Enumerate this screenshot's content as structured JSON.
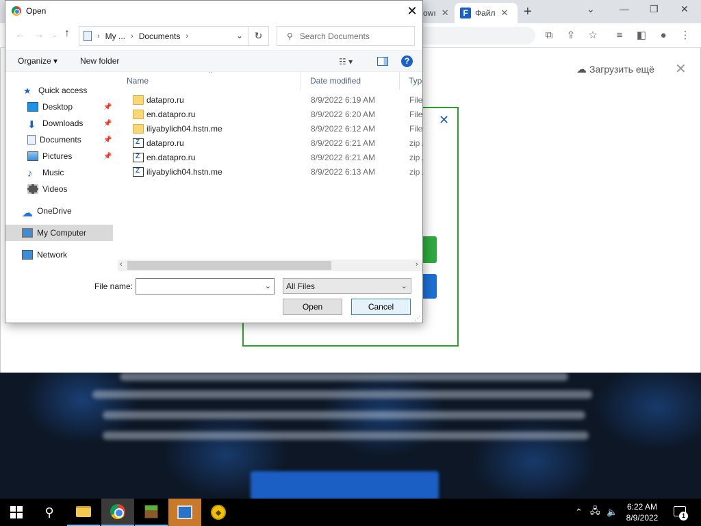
{
  "browser": {
    "tab_partial_label": "owı",
    "tab_active_label": "Файл",
    "tab_active_icon": "F",
    "upload_more": "Загрузить ещё"
  },
  "dialog": {
    "title": "Open",
    "breadcrumb": [
      "My ...",
      "Documents"
    ],
    "search_placeholder": "Search Documents",
    "organize": "Organize",
    "new_folder": "New folder",
    "help": "?",
    "nav": [
      {
        "label": "Quick access",
        "icon": "star-icon",
        "pinned": false
      },
      {
        "label": "Desktop",
        "icon": "desktop-icon",
        "pinned": true
      },
      {
        "label": "Downloads",
        "icon": "download-icon",
        "pinned": true
      },
      {
        "label": "Documents",
        "icon": "document-icon",
        "pinned": true
      },
      {
        "label": "Pictures",
        "icon": "pictures-icon",
        "pinned": true
      },
      {
        "label": "Music",
        "icon": "music-icon",
        "pinned": false
      },
      {
        "label": "Videos",
        "icon": "video-icon",
        "pinned": false
      },
      {
        "label": "OneDrive",
        "icon": "cloud-icon",
        "pinned": false
      },
      {
        "label": "My Computer",
        "icon": "computer-icon",
        "pinned": false
      },
      {
        "label": "Network",
        "icon": "network-icon",
        "pinned": false
      }
    ],
    "columns": {
      "name": "Name",
      "date": "Date modified",
      "type": "Type"
    },
    "files": [
      {
        "name": "datapro.ru",
        "date": "8/9/2022 6:19 AM",
        "type": "File fo",
        "kind": "folder"
      },
      {
        "name": "en.datapro.ru",
        "date": "8/9/2022 6:20 AM",
        "type": "File fo",
        "kind": "folder"
      },
      {
        "name": "iliyabylich04.hstn.me",
        "date": "8/9/2022 6:12 AM",
        "type": "File fo",
        "kind": "folder"
      },
      {
        "name": "datapro.ru",
        "date": "8/9/2022 6:21 AM",
        "type": "zip A",
        "kind": "zip"
      },
      {
        "name": "en.datapro.ru",
        "date": "8/9/2022 6:21 AM",
        "type": "zip A",
        "kind": "zip"
      },
      {
        "name": "iliyabylich04.hstn.me",
        "date": "8/9/2022 6:13 AM",
        "type": "zip A",
        "kind": "zip"
      }
    ],
    "file_name_label": "File name:",
    "file_name_value": "",
    "filter_value": "All Files",
    "open_button": "Open",
    "cancel_button": "Cancel"
  },
  "taskbar": {
    "time": "6:22 AM",
    "date": "8/9/2022",
    "notification_count": "1"
  },
  "colors": {
    "accent": "#1e63c4",
    "modal_border": "#2ba02b",
    "green_button": "#2eaa3f",
    "blue_button": "#1d6fd6"
  }
}
